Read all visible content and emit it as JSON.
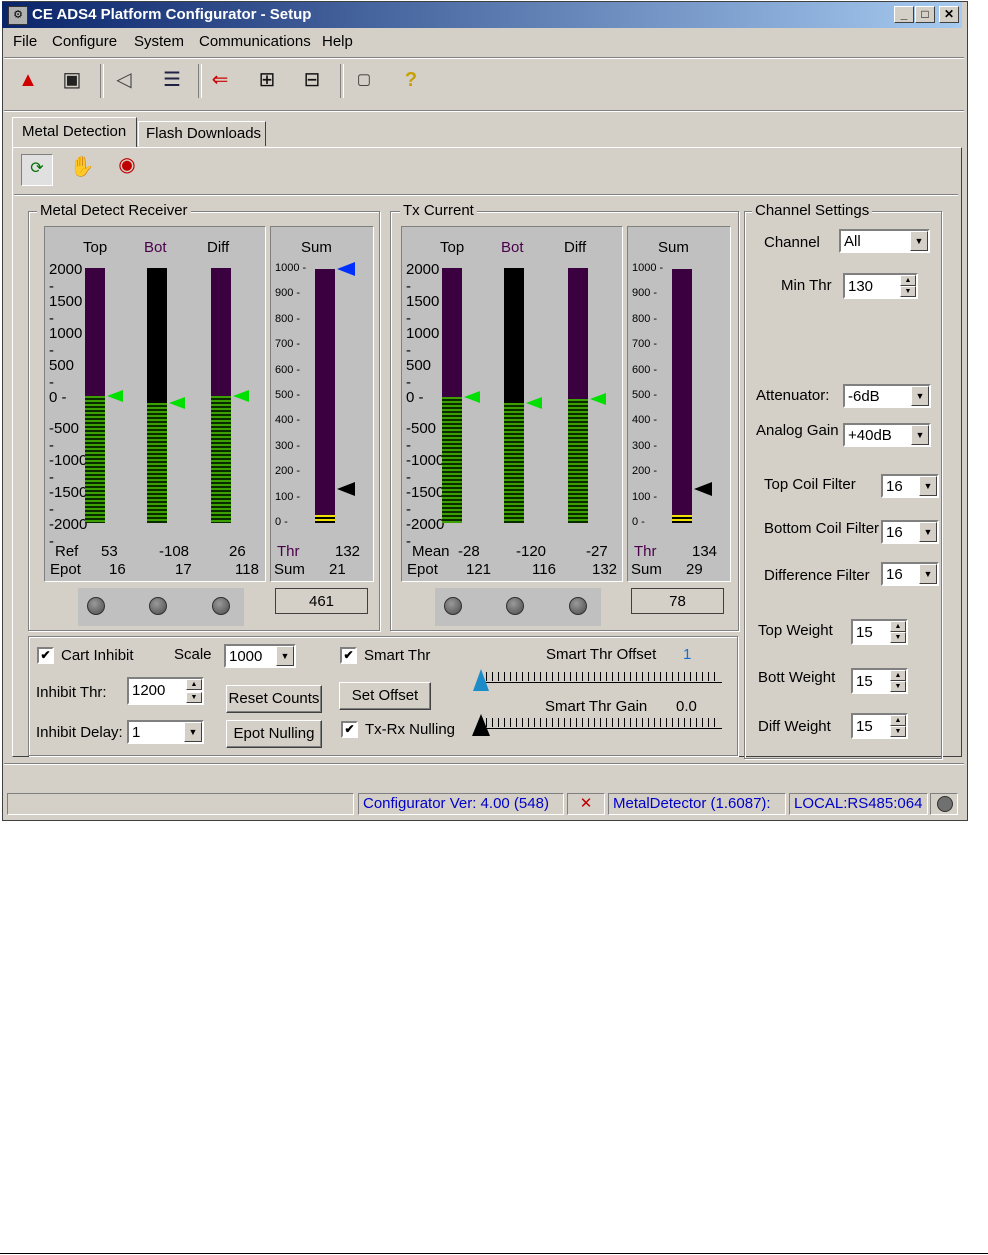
{
  "window": {
    "title": "CE ADS4 Platform Configurator - Setup",
    "min": "_",
    "max": "□",
    "close": "✕"
  },
  "menu": [
    "File",
    "Configure",
    "System",
    "Communications",
    "Help"
  ],
  "tabs": {
    "metal_detection": "Metal Detection",
    "flash_downloads": "Flash Downloads"
  },
  "receiver": {
    "label": "Metal Detect Receiver",
    "col_top": "Top",
    "col_bot": "Bot",
    "col_diff": "Diff",
    "col_sum": "Sum",
    "scale_ticks": [
      "2000",
      "1500",
      "1000",
      "500",
      "0",
      "-500",
      "-1000",
      "-1500",
      "-2000"
    ],
    "sum_ticks": [
      "1000",
      "900",
      "800",
      "700",
      "600",
      "500",
      "400",
      "300",
      "200",
      "100",
      "0"
    ],
    "ref_label": "Ref",
    "ref_top": "53",
    "ref_bot": "-108",
    "ref_diff": "26",
    "epot_label": "Epot",
    "epot_top": "16",
    "epot_bot": "17",
    "epot_diff": "118",
    "thr_label": "Thr",
    "thr_val": "132",
    "sum_label": "Sum",
    "sum_val": "21",
    "total": "461",
    "levels": {
      "top": 0.5,
      "bot": 0.47,
      "diff": 0.5,
      "sum_thr": 0.132,
      "sum_marker": 1.0
    }
  },
  "tx": {
    "label": "Tx Current",
    "col_top": "Top",
    "col_bot": "Bot",
    "col_diff": "Diff",
    "col_sum": "Sum",
    "scale_ticks": [
      "2000",
      "1500",
      "1000",
      "500",
      "0",
      "-500",
      "-1000",
      "-1500",
      "-2000"
    ],
    "sum_ticks": [
      "1000",
      "900",
      "800",
      "700",
      "600",
      "500",
      "400",
      "300",
      "200",
      "100",
      "0"
    ],
    "mean_label": "Mean",
    "mean_top": "-28",
    "mean_bot": "-120",
    "mean_diff": "-27",
    "epot_label": "Epot",
    "epot_top": "121",
    "epot_bot": "116",
    "epot_diff": "132",
    "thr_label": "Thr",
    "thr_val": "134",
    "sum_label": "Sum",
    "sum_val": "29",
    "total": "78"
  },
  "channel": {
    "label": "Channel Settings",
    "channel_label": "Channel",
    "channel_value": "All",
    "min_thr_label": "Min Thr",
    "min_thr_value": "130",
    "attenuator_label": "Attenuator:",
    "attenuator_value": "-6dB",
    "gain_label": "Analog Gain",
    "gain_value": "+40dB",
    "top_filter_label": "Top Coil Filter",
    "top_filter_value": "16",
    "bottom_filter_label": "Bottom Coil Filter",
    "bottom_filter_value": "16",
    "diff_filter_label": "Difference Filter",
    "diff_filter_value": "16",
    "top_weight_label": "Top Weight",
    "top_weight_value": "15",
    "bott_weight_label": "Bott Weight",
    "bott_weight_value": "15",
    "diff_weight_label": "Diff Weight",
    "diff_weight_value": "15"
  },
  "controls": {
    "cart_inhibit": "Cart Inhibit",
    "scale_label": "Scale",
    "scale_value": "1000",
    "inhibit_thr_label": "Inhibit Thr:",
    "inhibit_thr_value": "1200",
    "inhibit_delay_label": "Inhibit Delay:",
    "inhibit_delay_value": "1",
    "reset_counts": "Reset Counts",
    "epot_nulling": "Epot Nulling",
    "smart_thr": "Smart Thr",
    "set_offset": "Set Offset",
    "txrx_nulling": "Tx-Rx Nulling",
    "smart_offset_label": "Smart Thr Offset",
    "smart_offset_value": "1",
    "smart_gain_label": "Smart Thr Gain",
    "smart_gain_value": "0.0"
  },
  "status": {
    "version": "Configurator Ver: 4.00 (548)",
    "device": "MetalDetector (1.6087):",
    "port": "LOCAL:RS485:064"
  }
}
